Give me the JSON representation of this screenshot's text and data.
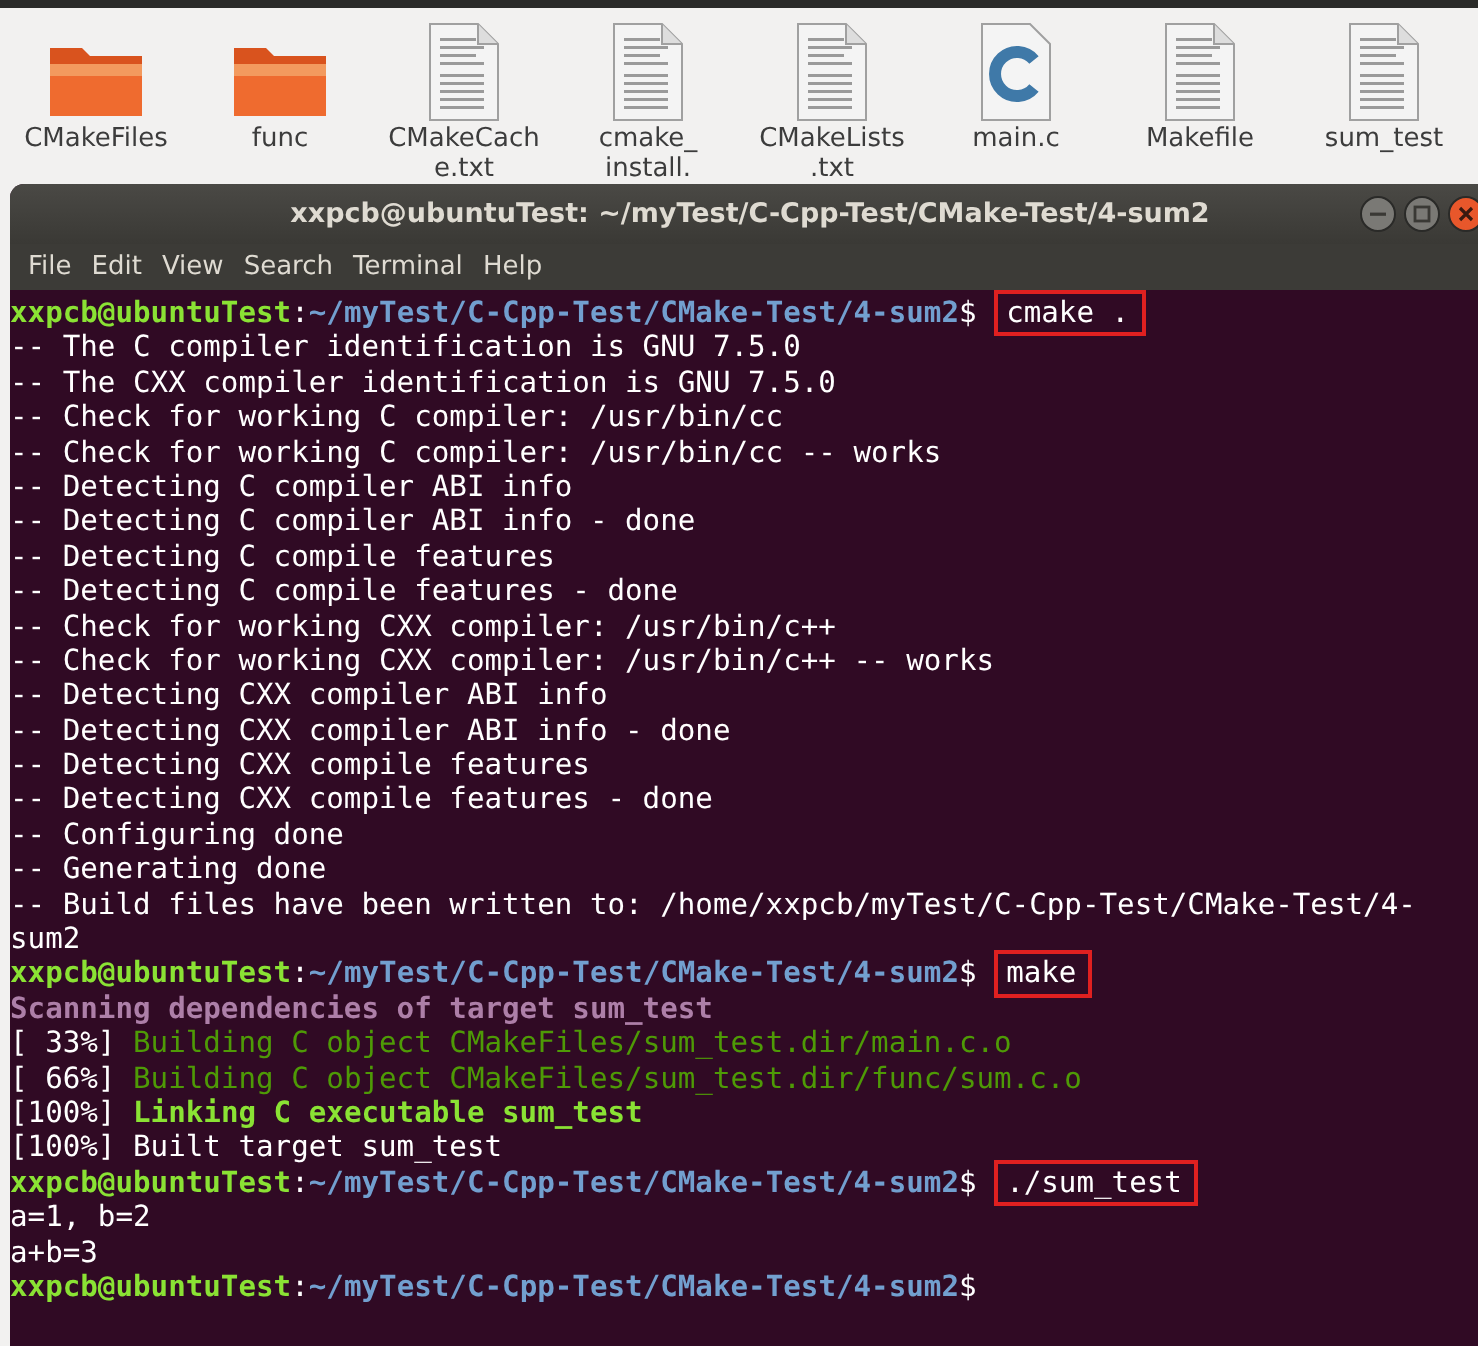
{
  "desktop": {
    "files": [
      {
        "kind": "folder",
        "label": [
          "CMakeFiles"
        ]
      },
      {
        "kind": "folder",
        "label": [
          "func"
        ]
      },
      {
        "kind": "text",
        "label": [
          "CMakeCach",
          "e.txt"
        ]
      },
      {
        "kind": "text",
        "label": [
          "cmake_",
          "install."
        ]
      },
      {
        "kind": "text",
        "label": [
          "CMakeLists",
          ".txt"
        ]
      },
      {
        "kind": "csource",
        "label": [
          "main.c"
        ]
      },
      {
        "kind": "text",
        "label": [
          "Makefile"
        ]
      },
      {
        "kind": "text",
        "label": [
          "sum_test"
        ]
      }
    ]
  },
  "window": {
    "title": "xxpcb@ubuntuTest: ~/myTest/C-Cpp-Test/CMake-Test/4-sum2"
  },
  "menu": [
    "File",
    "Edit",
    "View",
    "Search",
    "Terminal",
    "Help"
  ],
  "terminal": {
    "lines": [
      {
        "kind": "prompt",
        "user": "xxpcb@ubuntuTest",
        "sep": ":",
        "path": "~/myTest/C-Cpp-Test/CMake-Test/4-sum2",
        "sigil": "$",
        "command": "cmake ."
      },
      {
        "kind": "output",
        "text": "-- The C compiler identification is GNU 7.5.0"
      },
      {
        "kind": "output",
        "text": "-- The CXX compiler identification is GNU 7.5.0"
      },
      {
        "kind": "output",
        "text": "-- Check for working C compiler: /usr/bin/cc"
      },
      {
        "kind": "output",
        "text": "-- Check for working C compiler: /usr/bin/cc -- works"
      },
      {
        "kind": "output",
        "text": "-- Detecting C compiler ABI info"
      },
      {
        "kind": "output",
        "text": "-- Detecting C compiler ABI info - done"
      },
      {
        "kind": "output",
        "text": "-- Detecting C compile features"
      },
      {
        "kind": "output",
        "text": "-- Detecting C compile features - done"
      },
      {
        "kind": "output",
        "text": "-- Check for working CXX compiler: /usr/bin/c++"
      },
      {
        "kind": "output",
        "text": "-- Check for working CXX compiler: /usr/bin/c++ -- works"
      },
      {
        "kind": "output",
        "text": "-- Detecting CXX compiler ABI info"
      },
      {
        "kind": "output",
        "text": "-- Detecting CXX compiler ABI info - done"
      },
      {
        "kind": "output",
        "text": "-- Detecting CXX compile features"
      },
      {
        "kind": "output",
        "text": "-- Detecting CXX compile features - done"
      },
      {
        "kind": "output",
        "text": "-- Configuring done"
      },
      {
        "kind": "output",
        "text": "-- Generating done"
      },
      {
        "kind": "output",
        "text": "-- Build files have been written to: /home/xxpcb/myTest/C-Cpp-Test/CMake-Test/4-"
      },
      {
        "kind": "output",
        "text": "sum2"
      },
      {
        "kind": "prompt",
        "user": "xxpcb@ubuntuTest",
        "sep": ":",
        "path": "~/myTest/C-Cpp-Test/CMake-Test/4-sum2",
        "sigil": "$",
        "command": "make"
      },
      {
        "kind": "scan",
        "text": "Scanning dependencies of target sum_test"
      },
      {
        "kind": "build",
        "percent": "[ 33%]",
        "text": "Building C object CMakeFiles/sum_test.dir/main.c.o"
      },
      {
        "kind": "build",
        "percent": "[ 66%]",
        "text": "Building C object CMakeFiles/sum_test.dir/func/sum.c.o"
      },
      {
        "kind": "link",
        "percent": "[100%]",
        "text": "Linking C executable sum_test"
      },
      {
        "kind": "output",
        "text": "[100%] Built target sum_test"
      },
      {
        "kind": "prompt",
        "user": "xxpcb@ubuntuTest",
        "sep": ":",
        "path": "~/myTest/C-Cpp-Test/CMake-Test/4-sum2",
        "sigil": "$",
        "command": "./sum_test"
      },
      {
        "kind": "output",
        "text": "a=1, b=2"
      },
      {
        "kind": "output",
        "text": "a+b=3"
      },
      {
        "kind": "prompt",
        "user": "xxpcb@ubuntuTest",
        "sep": ":",
        "path": "~/myTest/C-Cpp-Test/CMake-Test/4-sum2",
        "sigil": "$"
      }
    ]
  }
}
